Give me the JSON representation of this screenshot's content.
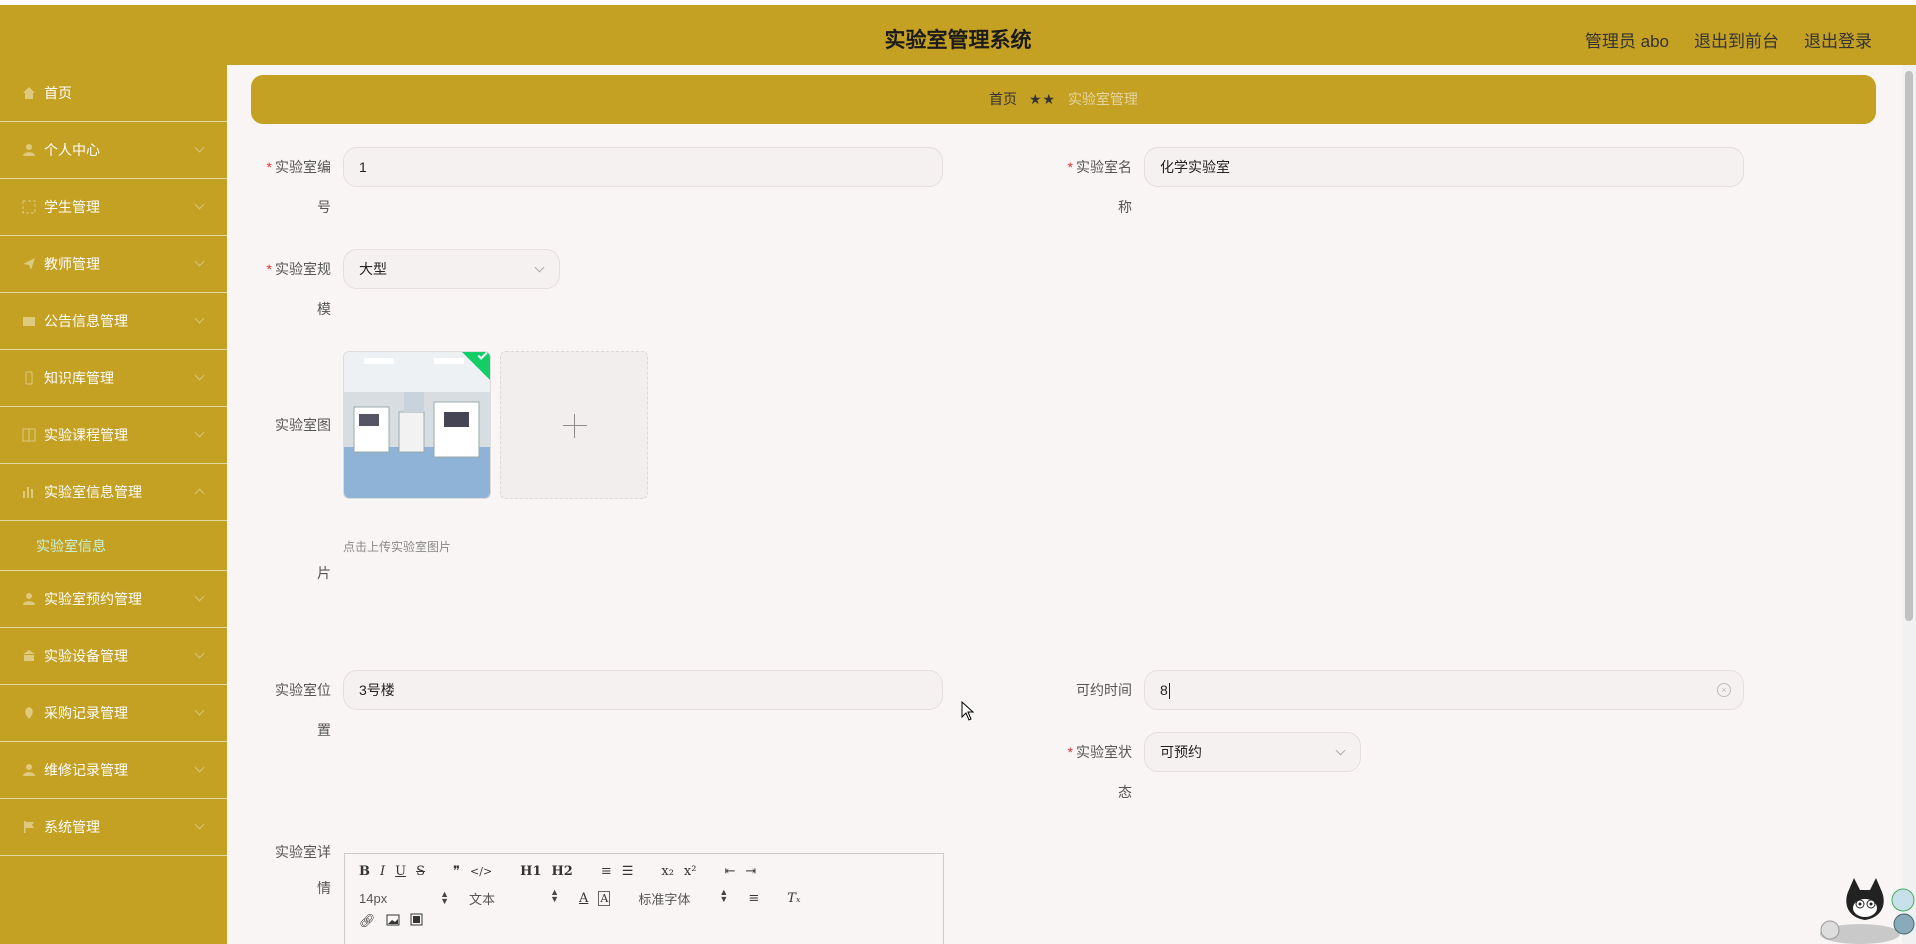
{
  "app": {
    "title": "实验室管理系统",
    "header_links": [
      "管理员 abo",
      "退出到前台",
      "退出登录"
    ]
  },
  "sidebar": {
    "items": [
      {
        "label": "首页",
        "icon": "home-icon"
      },
      {
        "label": "个人中心",
        "icon": "user-icon"
      },
      {
        "label": "学生管理",
        "icon": "frame-icon"
      },
      {
        "label": "教师管理",
        "icon": "send-icon"
      },
      {
        "label": "公告信息管理",
        "icon": "message-icon"
      },
      {
        "label": "知识库管理",
        "icon": "phone-icon"
      },
      {
        "label": "实验课程管理",
        "icon": "grid-icon"
      },
      {
        "label": "实验室信息管理",
        "icon": "bar-chart-icon"
      },
      {
        "label": "实验室预约管理",
        "icon": "user-icon"
      },
      {
        "label": "实验设备管理",
        "icon": "bank-icon"
      },
      {
        "label": "采购记录管理",
        "icon": "location-icon"
      },
      {
        "label": "维修记录管理",
        "icon": "user-icon"
      },
      {
        "label": "系统管理",
        "icon": "flag-icon"
      }
    ],
    "active_sub": "实验室信息"
  },
  "breadcrumb": {
    "home": "首页",
    "sep": "★★",
    "current": "实验室管理"
  },
  "form": {
    "lab_no": {
      "label_a": "实验室编",
      "label_b": "号",
      "value": "1"
    },
    "lab_name": {
      "label_a": "实验室名",
      "label_b": "称",
      "value": "化学实验室"
    },
    "lab_scale": {
      "label_a": "实验室规",
      "label_b": "模",
      "value": "大型"
    },
    "lab_image": {
      "label_a": "实验室图",
      "label_b": "片",
      "tip": "点击上传实验室图片"
    },
    "lab_location": {
      "label_a": "实验室位",
      "label_b": "置",
      "value": "3号楼"
    },
    "book_time": {
      "label": "可约时间",
      "value": "8"
    },
    "lab_status": {
      "label_a": "实验室状",
      "label_b": "态",
      "value": "可预约"
    },
    "lab_detail": {
      "label_a": "实验室详",
      "label_b": "情"
    }
  },
  "editor": {
    "row1": [
      "B",
      "I",
      "U",
      "S",
      "❞",
      "</>",
      "H1",
      "H2",
      "≡",
      "☰",
      "x₂",
      "x²",
      "⇤",
      "⇥"
    ],
    "font_size": "14px",
    "block_type": "文本",
    "font_family": "标准字体"
  },
  "colors": {
    "brand": "#c4a023",
    "content_bg": "#faf5f5",
    "active_sub": "#c8f0d8",
    "required": "#e03030"
  }
}
